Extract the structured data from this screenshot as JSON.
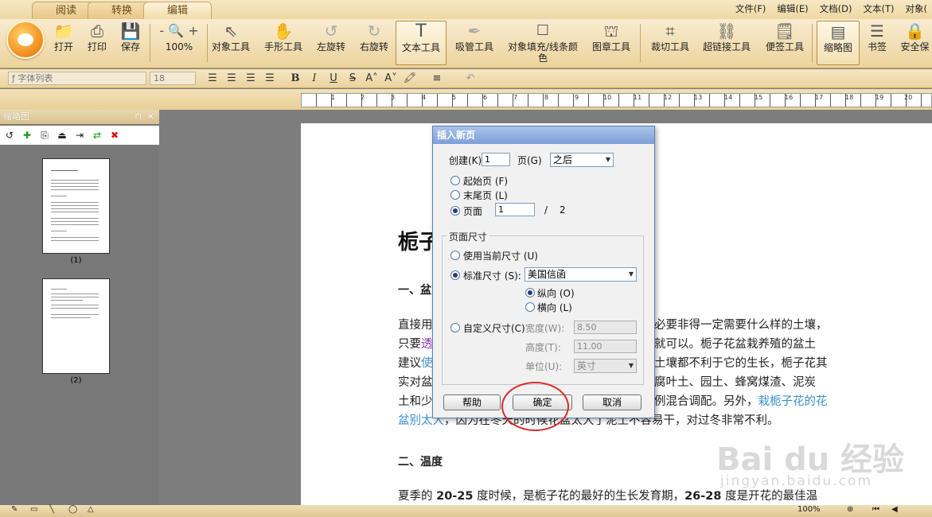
{
  "tabs": [
    "阅读",
    "转换",
    "编辑"
  ],
  "menus": [
    "文件(F)",
    "编辑(E)",
    "文档(D)",
    "文本(T)",
    "对象("
  ],
  "toolbar": {
    "open": "打开",
    "print": "打印",
    "save": "保存",
    "zoom": "100%",
    "zoom_minus": "-",
    "zoom_plus": "+",
    "object_tool": "对象工具",
    "hand_tool": "手形工具",
    "rotate_left": "左旋转",
    "rotate_right": "右旋转",
    "text_tool": "文本工具",
    "eyedropper": "吸管工具",
    "fill_line1": "对象填充/线条颜",
    "fill_line2": "色",
    "stamp_tool": "图章工具",
    "crop_tool": "裁切工具",
    "link_tool": "超链接工具",
    "note_tool": "便签工具",
    "thumbnail": "缩略图",
    "bookmark": "书签",
    "security": "安全保"
  },
  "format": {
    "font_list": "字体列表",
    "font_size": "18"
  },
  "ruler_numbers": [
    "1",
    "2",
    "3",
    "4",
    "5",
    "6",
    "7",
    "8",
    "9",
    "10",
    "11",
    "12",
    "13",
    "14",
    "15",
    "16",
    "17",
    "18",
    "19",
    "20"
  ],
  "thumbnails": {
    "title": "缩略图",
    "pages": [
      "(1)",
      "(2)"
    ]
  },
  "document": {
    "title": "栀子",
    "heading1": "一、盆",
    "p1_a": "直接用",
    "p1_b": "必要非得一定需要什么样的土壤，",
    "p2_a": "只要",
    "p2_link": "透",
    "p2_b": "就可以。栀子花盆栽养殖的盆土",
    "p3_a": "建议",
    "p3_link": "使",
    "p3_b": "土壤都不利于它的生长，栀子花其",
    "p4_a": "实对盆",
    "p4_b": "腐叶土、园土、蜂窝煤渣、泥炭",
    "p5_a": "土和少",
    "p5_b": "例混合调配。另外，",
    "p5_link": "栽栀子花的花",
    "p6_link": "盆别太大",
    "p6_b": "，因为在冬天的时候花盆太大了泥土不容易干，对过冬非常不利。",
    "heading2": "二、温度",
    "p7_a": "夏季的 ",
    "p7_b1": "20-25",
    "p7_c": " 度时候，是栀子花的最好的生长发育期，",
    "p7_b2": "26-28",
    "p7_d": " 度是开花的最佳温"
  },
  "dialog": {
    "title": "插入新页",
    "create_label": "创建(K)",
    "create_value": "1",
    "page_label": "页(G)",
    "position_value": "之后",
    "first_page": "起始页 (F)",
    "last_page": "末尾页 (L)",
    "page_opt": "页面",
    "page_value": "1",
    "page_sep": "/",
    "page_total": "2",
    "page_size_group": "页面尺寸",
    "use_current": "使用当前尺寸 (U)",
    "standard": "标准尺寸 (S):",
    "standard_value": "美国信函",
    "portrait": "纵向 (O)",
    "landscape": "横向 (L)",
    "custom": "自定义尺寸(C)",
    "width_label": "宽度(W):",
    "width_value": "8.50",
    "height_label": "高度(T):",
    "height_value": "11.00",
    "unit_label": "单位(U):",
    "unit_value": "英寸",
    "help": "帮助",
    "ok": "确定",
    "cancel": "取消"
  },
  "watermark": {
    "brand": "Bai du 经验",
    "url": "jingyan.baidu.com"
  },
  "status": {
    "zoom": "100%"
  }
}
